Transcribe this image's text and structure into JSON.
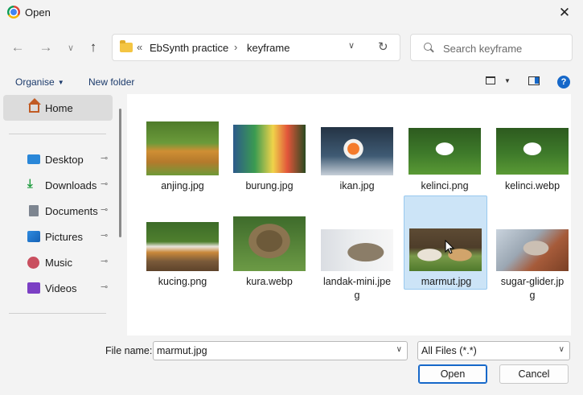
{
  "window": {
    "title": "Open",
    "close_icon": "close-icon"
  },
  "navigation": {
    "back_icon": "arrow-left-icon",
    "forward_icon": "arrow-right-icon",
    "recent_icon": "chevron-down-icon",
    "up_icon": "arrow-up-icon"
  },
  "address": {
    "overflow": "«",
    "crumbs": [
      "EbSynth practice",
      "keyframe"
    ],
    "separator": "›",
    "dropdown_icon": "chevron-down-icon",
    "refresh_icon": "refresh-icon"
  },
  "search": {
    "placeholder": "Search keyframe",
    "value": ""
  },
  "commands": {
    "organise": "Organise",
    "new_folder": "New folder",
    "help": "?"
  },
  "sidebar": {
    "home": "Home",
    "items": [
      {
        "label": "Desktop",
        "icon": "desktop-icon",
        "pinned": true
      },
      {
        "label": "Downloads",
        "icon": "downloads-icon",
        "pinned": true
      },
      {
        "label": "Documents",
        "icon": "documents-icon",
        "pinned": true
      },
      {
        "label": "Pictures",
        "icon": "pictures-icon",
        "pinned": true
      },
      {
        "label": "Music",
        "icon": "music-icon",
        "pinned": true
      },
      {
        "label": "Videos",
        "icon": "videos-icon",
        "pinned": true
      }
    ],
    "pin_glyph": "📌"
  },
  "files": {
    "items": [
      {
        "name": "anjing.jpg",
        "line2": ""
      },
      {
        "name": "burung.jpg",
        "line2": ""
      },
      {
        "name": "ikan.jpg",
        "line2": ""
      },
      {
        "name": "kelinci.png",
        "line2": ""
      },
      {
        "name": "kelinci.webp",
        "line2": ""
      },
      {
        "name": "kucing.png",
        "line2": ""
      },
      {
        "name": "kura.webp",
        "line2": ""
      },
      {
        "name": "landak-mini.jpe",
        "line2": "g"
      },
      {
        "name": "marmut.jpg",
        "line2": ""
      },
      {
        "name": "sugar-glider.jp",
        "line2": "g"
      }
    ],
    "selected": "marmut.jpg"
  },
  "footer": {
    "file_name_label": "File name:",
    "file_name_value": "marmut.jpg",
    "file_type": "All Files (*.*)",
    "open_label": "Open",
    "cancel_label": "Cancel"
  },
  "colors": {
    "accent": "#1668c9",
    "selection": "#cce4f7"
  }
}
